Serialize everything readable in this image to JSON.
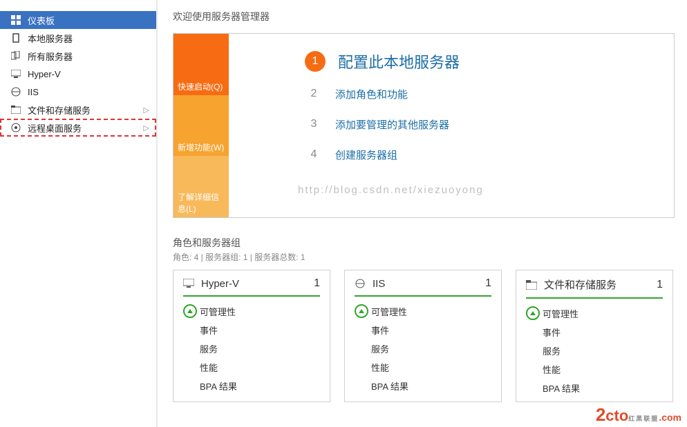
{
  "sidebar": {
    "items": [
      {
        "label": "仪表板",
        "icon": "dashboard-icon",
        "selected": true
      },
      {
        "label": "本地服务器",
        "icon": "server-icon"
      },
      {
        "label": "所有服务器",
        "icon": "servers-icon"
      },
      {
        "label": "Hyper-V",
        "icon": "hyperv-icon"
      },
      {
        "label": "IIS",
        "icon": "iis-icon"
      },
      {
        "label": "文件和存储服务",
        "icon": "file-icon",
        "chev": true
      },
      {
        "label": "远程桌面服务",
        "icon": "rds-icon",
        "chev": true,
        "redbox": true
      }
    ]
  },
  "welcome": {
    "title": "欢迎使用服务器管理器",
    "orange": [
      "快速启动(Q)",
      "新增功能(W)",
      "了解详细信息(L)"
    ],
    "steps": [
      {
        "num": "1",
        "text": "配置此本地服务器",
        "primary": true
      },
      {
        "num": "2",
        "text": "添加角色和功能"
      },
      {
        "num": "3",
        "text": "添加要管理的其他服务器"
      },
      {
        "num": "4",
        "text": "创建服务器组"
      }
    ],
    "watermark": "http://blog.csdn.net/xiezuoyong"
  },
  "roles": {
    "title": "角色和服务器组",
    "subtitle": "角色: 4 | 服务器组: 1 | 服务器总数: 1",
    "cards": [
      {
        "title": "Hyper-V",
        "count": "1",
        "lines": [
          "可管理性",
          "事件",
          "服务",
          "性能",
          "BPA 结果"
        ]
      },
      {
        "title": "IIS",
        "count": "1",
        "lines": [
          "可管理性",
          "事件",
          "服务",
          "性能",
          "BPA 结果"
        ]
      },
      {
        "title": "文件和存储服务",
        "count": "1",
        "lines": [
          "可管理性",
          "事件",
          "服务",
          "性能",
          "BPA 结果"
        ]
      }
    ]
  },
  "logo": {
    "brand": "2cto",
    "suffix": ".com",
    "tag": "红黑联盟"
  }
}
